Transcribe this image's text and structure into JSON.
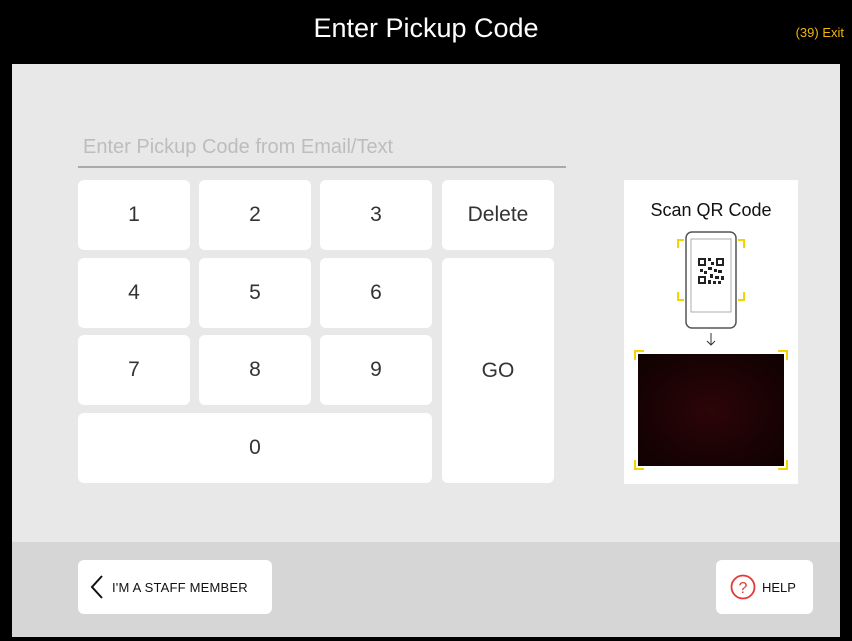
{
  "header": {
    "title": "Enter Pickup Code",
    "exit_label": "(39) Exit"
  },
  "code_input": {
    "placeholder": "Enter Pickup Code from Email/Text",
    "value": ""
  },
  "keypad": {
    "k1": "1",
    "k2": "2",
    "k3": "3",
    "k4": "4",
    "k5": "5",
    "k6": "6",
    "k7": "7",
    "k8": "8",
    "k9": "9",
    "k0": "0",
    "delete": "Delete",
    "go": "GO"
  },
  "qr_scan": {
    "title": "Scan QR Code",
    "arrow": "↓"
  },
  "footer": {
    "staff_label": "I'M A STAFF MEMBER",
    "help_label": "HELP",
    "help_symbol": "?"
  },
  "colors": {
    "accent_yellow": "#f2b705",
    "help_red": "#e53935",
    "panel_gray": "#e8e8e8",
    "footer_gray": "#d6d6d6"
  }
}
